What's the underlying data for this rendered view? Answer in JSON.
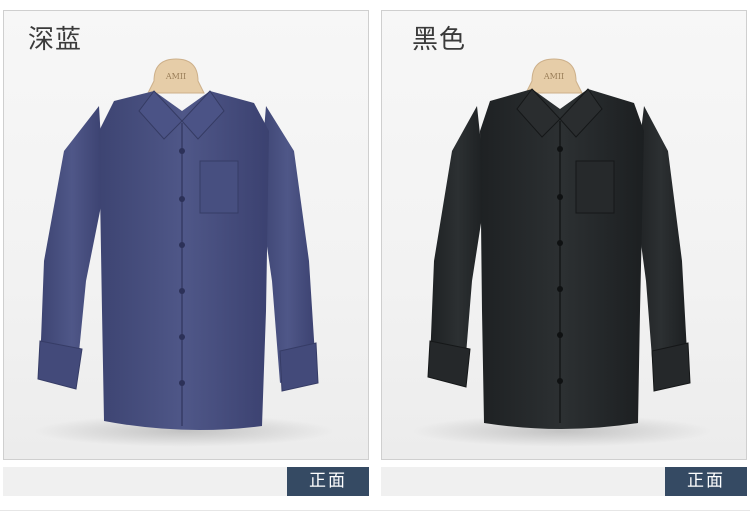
{
  "products": [
    {
      "color_name": "深蓝",
      "view_label": "正面",
      "hanger_brand": "AMII",
      "shirt_color": "#4a5180",
      "icon": "shirt-image"
    },
    {
      "color_name": "黑色",
      "view_label": "正面",
      "hanger_brand": "AMII",
      "shirt_color": "#26292b",
      "icon": "shirt-image"
    }
  ],
  "accent": "#354a63"
}
